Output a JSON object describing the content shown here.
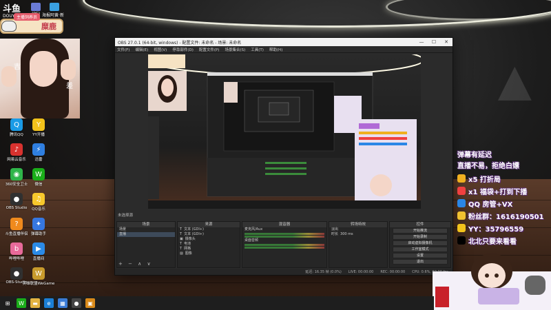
{
  "top_left": {
    "logo": "斗鱼",
    "logo_sub": "DOUYU.COM",
    "icons": [
      {
        "label": "(PE)",
        "color": "#6a7bd6"
      },
      {
        "label": "向日葵",
        "color": "#f28a2b"
      },
      {
        "label": "海报阿黄·新版",
        "color": "#3aa0e0"
      }
    ],
    "name_tag_top": "主播饲养员",
    "name_tag": "糜鹿"
  },
  "webcam": {
    "text_left": "吉",
    "text_right": "差"
  },
  "desktop_icons": [
    {
      "label": "腾讯QQ",
      "glyph": "Q",
      "color": "#1a9be6"
    },
    {
      "label": "网易云音乐",
      "glyph": "♪",
      "color": "#d8322f"
    },
    {
      "label": "360安全卫士",
      "glyph": "◉",
      "color": "#2fb54a"
    },
    {
      "label": "微信",
      "glyph": "W",
      "color": "#1aad19"
    },
    {
      "label": "OBS Studio",
      "glyph": "●",
      "color": "#303030"
    },
    {
      "label": "QQ音乐",
      "glyph": "♫",
      "color": "#f7c82c"
    },
    {
      "label": "斗鱼直播伴侣",
      "glyph": "?",
      "color": "#f08a1d"
    },
    {
      "label": "弹幕助手",
      "glyph": "✦",
      "color": "#3677e0"
    },
    {
      "label": "YY开播",
      "glyph": "Y",
      "color": "#f2c21b"
    },
    {
      "label": "迅雷",
      "glyph": "⚡",
      "color": "#2f7fe0"
    },
    {
      "label": "哔哩哔哩",
      "glyph": "b",
      "color": "#e86a9a"
    },
    {
      "label": "直播间",
      "glyph": "▶",
      "color": "#2b8ae6"
    },
    {
      "label": "OBS-Studio",
      "glyph": "●",
      "color": "#303030"
    },
    {
      "label": "英雄联盟WeGame",
      "glyph": "W",
      "color": "#c79a2c"
    }
  ],
  "obs": {
    "title": "OBS 27.0.1 (64-bit, windows) - 配置文件: 未命名 - 场景: 未命名",
    "menus": [
      "文件(F)",
      "编辑(E)",
      "视图(V)",
      "停靠部件(D)",
      "配置文件(P)",
      "场景集合(S)",
      "工具(T)",
      "帮助(H)"
    ],
    "status_label": "未选择源",
    "docks": {
      "scenes": {
        "title": "场景",
        "items": [
          "场景",
          "直播"
        ]
      },
      "sources": {
        "title": "来源",
        "items": [
          "文本 (GDI+)",
          "文本 (GDI+)",
          "摄像头",
          "电池",
          "网格",
          "图像"
        ]
      },
      "mixer": {
        "title": "混音器",
        "items": [
          "麦克风/Aux",
          "桌面音频"
        ]
      },
      "transitions": {
        "title": "转场特效",
        "fade": "淡出",
        "duration_label": "时长",
        "duration": "300 ms"
      },
      "controls": {
        "title": "控件",
        "buttons": [
          "开始推流",
          "开始录制",
          "启动虚拟摄像机",
          "工作室模式",
          "设置",
          "退出"
        ]
      }
    },
    "bottom": {
      "live": "LIVE: 00:00:00",
      "rec": "REC: 00:00:00",
      "cpu": "CPU: 0.6%, 60.00 fps",
      "extra": "延迟: 16.35 帧 (0.0%)"
    }
  },
  "overlay": {
    "line1": "弹幕有延迟",
    "line2": "直播不易，拒绝白嫖",
    "items": [
      {
        "text": "x5 打折局",
        "color": "#f0b020"
      },
      {
        "text": "x1 福袋+打到下播",
        "color": "#f04040"
      },
      {
        "text": "QQ 房管+VX",
        "color": "#2a86e6"
      },
      {
        "text": "粉丝群：1616190501",
        "color": "#f0c030"
      },
      {
        "text": "YY：35796559",
        "color": "#f2c21b"
      },
      {
        "text": "北北只要来看看",
        "color": "#000000"
      }
    ]
  },
  "taskbar": {
    "icons": [
      {
        "name": "windows-icon",
        "glyph": "⊞",
        "color": "#1e1e1e"
      },
      {
        "name": "wechat-icon",
        "glyph": "W",
        "color": "#1aad19"
      },
      {
        "name": "folder-icon",
        "glyph": "▬",
        "color": "#e3b341"
      },
      {
        "name": "edge-icon",
        "glyph": "e",
        "color": "#1b7fd6"
      },
      {
        "name": "store-icon",
        "glyph": "▦",
        "color": "#3a7bd5"
      },
      {
        "name": "obs-icon",
        "glyph": "●",
        "color": "#444"
      },
      {
        "name": "app-icon",
        "glyph": "▣",
        "color": "#d98a1a"
      }
    ]
  }
}
